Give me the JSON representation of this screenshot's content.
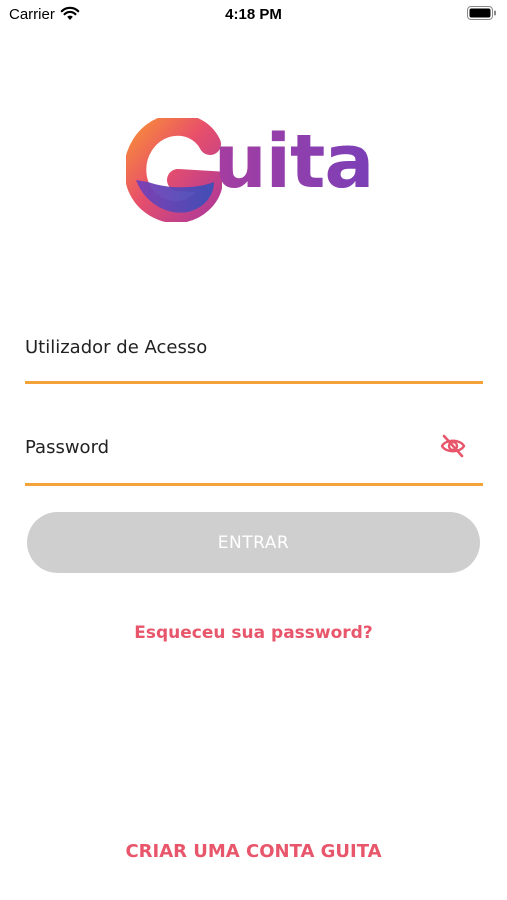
{
  "status_bar": {
    "carrier": "Carrier",
    "time": "4:18 PM",
    "icons": [
      "wifi-icon",
      "battery-icon"
    ]
  },
  "logo": {
    "text": "uita",
    "full_name": "Guita",
    "colors": {
      "orange": "#f26b3a",
      "magenta": "#c23a8c",
      "purple": "#7a3fb6",
      "blue": "#3a4fb6"
    }
  },
  "form": {
    "username": {
      "placeholder": "Utilizador de Acesso",
      "value": ""
    },
    "password": {
      "placeholder": "Password",
      "value": "",
      "toggle_icon": "eye-off-icon"
    },
    "submit_label": "ENTRAR",
    "underline_color": "#f3a33a",
    "button_color": "#cfcfcf"
  },
  "links": {
    "forgot_password": "Esqueceu sua password?",
    "create_account": "CRIAR UMA CONTA GUITA",
    "color": "#e8566b"
  }
}
